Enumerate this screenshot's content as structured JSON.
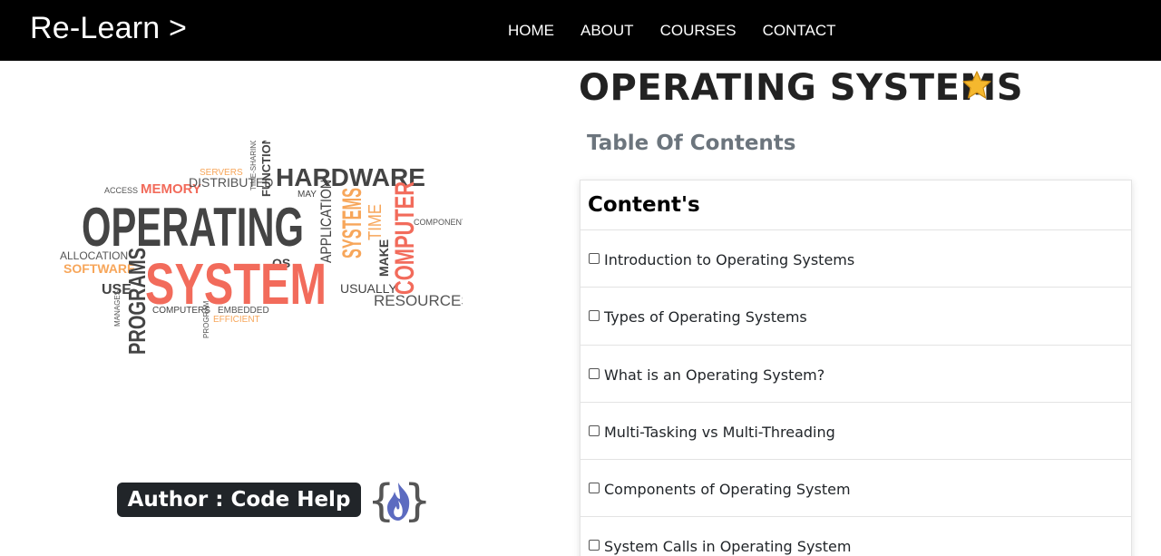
{
  "navbar": {
    "brand": "Re-Learn >",
    "links": [
      "HOME",
      "ABOUT",
      "COURSES",
      "CONTACT"
    ]
  },
  "hero_image": {
    "words": {
      "main1": "OPERATING",
      "main2": "SYSTEM",
      "hardware": "HARDWARE",
      "programs": "PROGRAMS",
      "systems": "SYSTEMS",
      "computer": "COMPUTER",
      "application": "APPLICATION",
      "resources": "RESOURCES",
      "memory": "MEMORY",
      "distributed": "DISTRIBUTED",
      "servers": "SERVERS",
      "function": "FUNCTION",
      "time_sharing": "TIME-SHARING",
      "software": "SOFTWARE",
      "allocation": "ALLOCATION",
      "use": "USE",
      "time": "TIME",
      "make": "MAKE",
      "usually": "USUALLY",
      "component": "COMPONENT",
      "access": "ACCESS",
      "computers": "COMPUTERS",
      "embedded": "EMBEDDED",
      "efficient": "EFFICIENT",
      "os": "OS",
      "may": "MAY",
      "manages": "MANAGES",
      "program": "PROGRAM"
    }
  },
  "author": {
    "label": "Author : Code Help"
  },
  "main": {
    "title": "OPERATING SYSTEMS",
    "toc_heading": "Table Of Contents",
    "card_title": "Content's",
    "items": [
      "Introduction to Operating Systems",
      "Types of Operating Systems",
      "What is an Operating System?",
      "Multi-Tasking vs Multi-Threading",
      "Components of Operating System",
      "System Calls in Operating System"
    ]
  },
  "colors": {
    "navbar_bg": "#000000",
    "accent_red": "#f26b5b",
    "accent_orange": "#f7a65a",
    "dark_gray": "#444444",
    "badge_bg": "#212529",
    "logo_blue": "#5c6bc0",
    "star": "#f5b82e"
  }
}
